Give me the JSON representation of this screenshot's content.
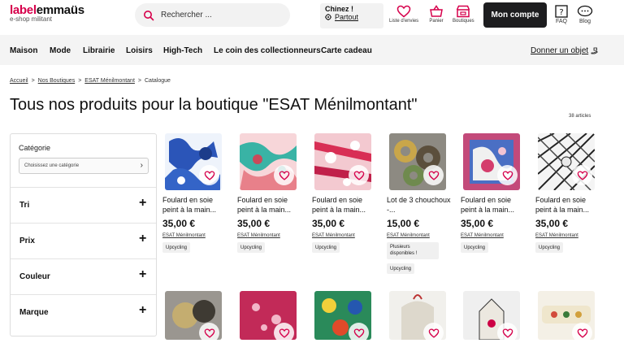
{
  "header": {
    "logo_part1": "label",
    "logo_part2": "emmaüs",
    "logo_tagline": "e-shop militant",
    "search_placeholder": "Rechercher ...",
    "chinez_title": "Chinez !",
    "chinez_location": "Partout",
    "icons": [
      {
        "name": "heart-icon",
        "label": "Liste d'envies"
      },
      {
        "name": "basket-icon",
        "label": "Panier"
      },
      {
        "name": "shop-icon",
        "label": "Boutiques"
      }
    ],
    "account_label": "Mon compte",
    "faq_label": "FAQ",
    "blog_label": "Blog",
    "accent": "#d6004b"
  },
  "nav": {
    "items": [
      "Maison",
      "Mode",
      "Librairie",
      "Loisirs",
      "High-Tech",
      "Le coin des collectionneurs",
      "Carte cadeau"
    ],
    "donate": "Donner un objet"
  },
  "breadcrumb": [
    "Accueil",
    "Nos Boutiques",
    "ESAT Ménilmontant",
    "Catalogue"
  ],
  "page_title": "Tous nos produits pour la boutique \"ESAT Ménilmontant\"",
  "article_count": "38 articles",
  "sidebar": {
    "category_label": "Catégorie",
    "category_placeholder": "Choisissez une catégorie",
    "filters": [
      "Tri",
      "Prix",
      "Couleur",
      "Marque"
    ]
  },
  "products": [
    {
      "name": "Foulard en soie peint à la main...",
      "price": "35,00 €",
      "shop": "ESAT Ménilmontant",
      "tags": [
        "Upcycling"
      ],
      "multi": ""
    },
    {
      "name": "Foulard en soie peint à la main...",
      "price": "35,00 €",
      "shop": "ESAT Ménilmontant",
      "tags": [
        "Upcycling"
      ],
      "multi": ""
    },
    {
      "name": "Foulard en soie peint à la main...",
      "price": "35,00 €",
      "shop": "ESAT Ménilmontant",
      "tags": [
        "Upcycling"
      ],
      "multi": ""
    },
    {
      "name": "Lot de 3 chouchoux -...",
      "price": "15,00 €",
      "shop": "ESAT Ménilmontant",
      "tags": [
        "Upcycling"
      ],
      "multi": "Plusieurs disponibles !"
    },
    {
      "name": "Foulard en soie peint à la main...",
      "price": "35,00 €",
      "shop": "ESAT Ménilmontant",
      "tags": [
        "Upcycling"
      ],
      "multi": ""
    },
    {
      "name": "Foulard en soie peint à la main...",
      "price": "35,00 €",
      "shop": "ESAT Ménilmontant",
      "tags": [
        "Upcycling"
      ],
      "multi": ""
    }
  ]
}
